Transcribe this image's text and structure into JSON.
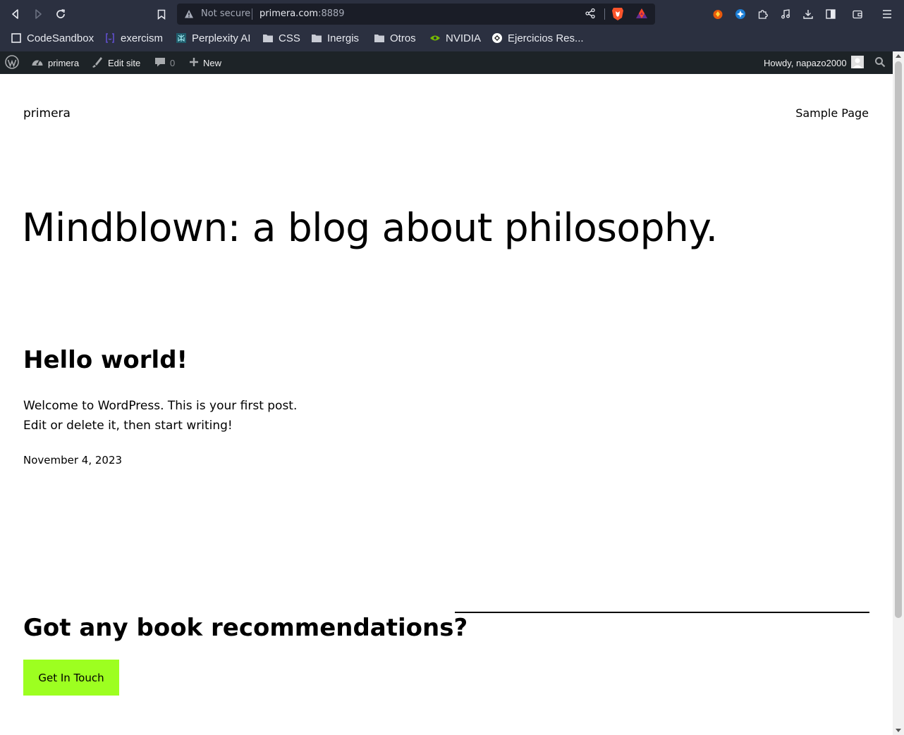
{
  "browser": {
    "address_bar": {
      "security_label": "Not secure",
      "host": "primera.com",
      "port": ":8889"
    },
    "bookmarks": [
      {
        "label": "CodeSandbox",
        "icon": "codesandbox-icon"
      },
      {
        "label": "exercism",
        "icon": "exercism-icon"
      },
      {
        "label": "Perplexity AI",
        "icon": "perplexity-icon"
      },
      {
        "label": "CSS",
        "icon": "folder-icon"
      },
      {
        "label": "Inergis",
        "icon": "folder-icon"
      },
      {
        "label": "Otros",
        "icon": "folder-icon"
      },
      {
        "label": "NVIDIA",
        "icon": "nvidia-icon"
      },
      {
        "label": "Ejercicios Res...",
        "icon": "ejercicios-icon"
      }
    ]
  },
  "admin_bar": {
    "site_name": "primera",
    "edit_site": "Edit site",
    "comments_count": "0",
    "new_label": "New",
    "greeting": "Howdy, napazo2000"
  },
  "site": {
    "title": "primera",
    "nav": {
      "sample_page": "Sample Page"
    },
    "hero_heading": "Mindblown: a blog about philosophy.",
    "post": {
      "title": "Hello world!",
      "excerpt_line1": "Welcome to WordPress. This is your first post.",
      "excerpt_line2": "Edit or delete it, then start writing!",
      "date": "November 4, 2023"
    },
    "cta": {
      "heading": "Got any book recommendations?",
      "button_label": "Get In Touch"
    }
  },
  "colors": {
    "browser_chrome": "#2b3040",
    "admin_bar": "#1d2327",
    "cta_button": "#9dff20"
  }
}
